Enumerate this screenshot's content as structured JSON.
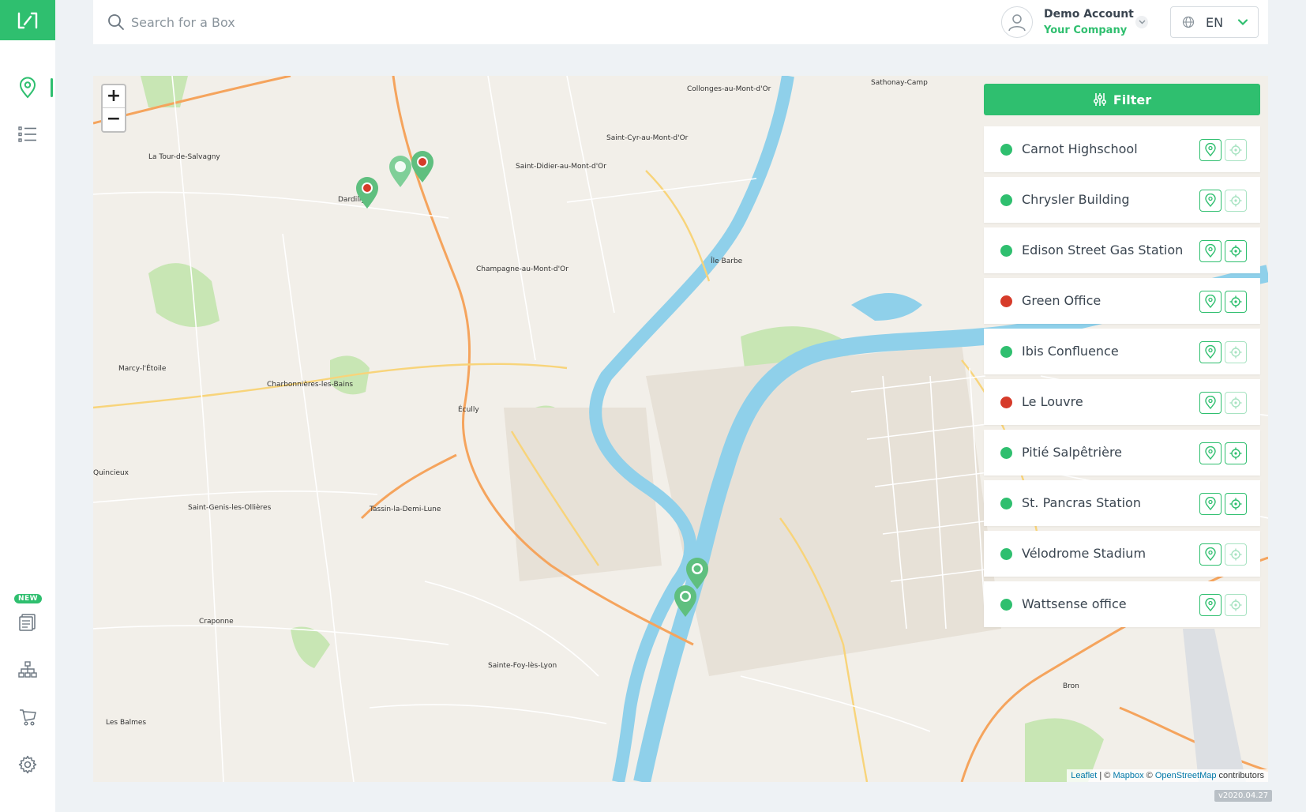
{
  "sidebar": {
    "nav": [
      {
        "name": "map",
        "icon": "map-pin-icon",
        "active": true
      },
      {
        "name": "list",
        "icon": "list-icon",
        "active": false
      },
      {
        "name": "reports",
        "icon": "reports-icon",
        "active": false,
        "badge": "NEW"
      },
      {
        "name": "network",
        "icon": "network-icon",
        "active": false
      },
      {
        "name": "cart",
        "icon": "cart-icon",
        "active": false
      },
      {
        "name": "settings",
        "icon": "gear-icon",
        "active": false
      }
    ],
    "badge_label": "NEW"
  },
  "header": {
    "search_placeholder": "Search for a Box",
    "account_name": "Demo Account",
    "account_company": "Your Company",
    "language": "EN"
  },
  "map": {
    "zoom_in": "+",
    "zoom_out": "−",
    "places": [
      "Collonges-au-Mont-d'Or",
      "Sathonay-Camp",
      "La Tour-de-Salvagny",
      "Dardilly",
      "Saint-Cyr-au-Mont-d'Or",
      "Saint-Didier-au-Mont-d'Or",
      "Champagne-au-Mont-d'Or",
      "Marcy-l'Étoile",
      "Charbonnières-les-Bains",
      "Écully",
      "Tassin-la-Demi-Lune",
      "Saint-Genis-les-Ollières",
      "Craponne",
      "Sainte-Foy-lès-Lyon",
      "Bron",
      "Les Balmes",
      "Quincieux",
      "Île Barbe"
    ],
    "attribution": {
      "leaflet": "Leaflet",
      "sep1": " | © ",
      "mapbox": "Mapbox",
      "sep2": " © ",
      "osm": "OpenStreetMap",
      "suffix": " contributors"
    }
  },
  "filter": {
    "label": "Filter"
  },
  "boxes": [
    {
      "name": "Carnot Highschool",
      "status": "green",
      "second_action_active": false
    },
    {
      "name": "Chrysler Building",
      "status": "green",
      "second_action_active": false
    },
    {
      "name": "Edison Street Gas Station",
      "status": "green",
      "second_action_active": true
    },
    {
      "name": "Green Office",
      "status": "red",
      "second_action_active": true
    },
    {
      "name": "Ibis Confluence",
      "status": "green",
      "second_action_active": false
    },
    {
      "name": "Le Louvre",
      "status": "red",
      "second_action_active": false
    },
    {
      "name": "Pitié Salpêtrière",
      "status": "green",
      "second_action_active": true
    },
    {
      "name": "St. Pancras Station",
      "status": "green",
      "second_action_active": true
    },
    {
      "name": "Vélodrome Stadium",
      "status": "green",
      "second_action_active": false
    },
    {
      "name": "Wattsense office",
      "status": "green",
      "second_action_active": false
    }
  ],
  "colors": {
    "accent": "#2fbf6f",
    "status_green": "#2fbf6f",
    "status_red": "#d63b2a",
    "water": "#8fd0ea",
    "park": "#bfe3a8"
  },
  "version": "v2020.04.27"
}
